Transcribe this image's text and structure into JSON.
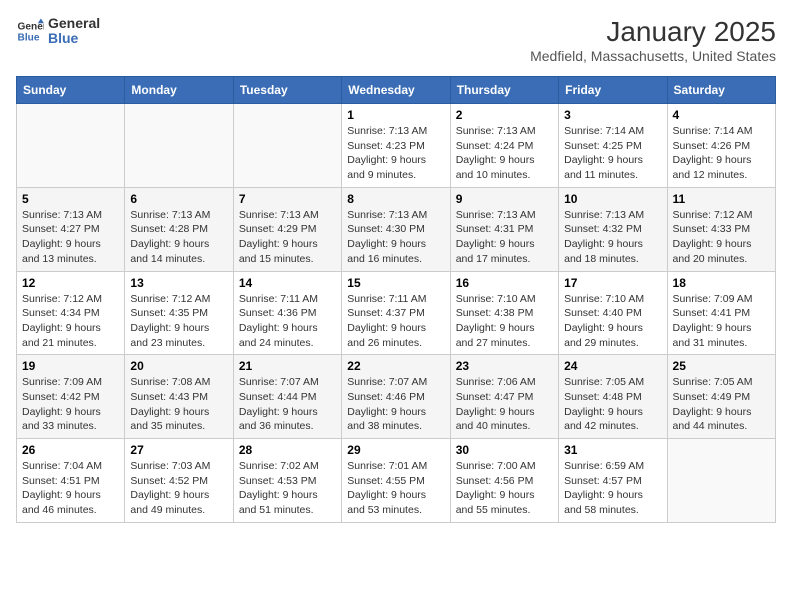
{
  "header": {
    "logo_line1": "General",
    "logo_line2": "Blue",
    "title": "January 2025",
    "subtitle": "Medfield, Massachusetts, United States"
  },
  "days_of_week": [
    "Sunday",
    "Monday",
    "Tuesday",
    "Wednesday",
    "Thursday",
    "Friday",
    "Saturday"
  ],
  "weeks": [
    [
      {
        "day": "",
        "info": ""
      },
      {
        "day": "",
        "info": ""
      },
      {
        "day": "",
        "info": ""
      },
      {
        "day": "1",
        "info": "Sunrise: 7:13 AM\nSunset: 4:23 PM\nDaylight: 9 hours\nand 9 minutes."
      },
      {
        "day": "2",
        "info": "Sunrise: 7:13 AM\nSunset: 4:24 PM\nDaylight: 9 hours\nand 10 minutes."
      },
      {
        "day": "3",
        "info": "Sunrise: 7:14 AM\nSunset: 4:25 PM\nDaylight: 9 hours\nand 11 minutes."
      },
      {
        "day": "4",
        "info": "Sunrise: 7:14 AM\nSunset: 4:26 PM\nDaylight: 9 hours\nand 12 minutes."
      }
    ],
    [
      {
        "day": "5",
        "info": "Sunrise: 7:13 AM\nSunset: 4:27 PM\nDaylight: 9 hours\nand 13 minutes."
      },
      {
        "day": "6",
        "info": "Sunrise: 7:13 AM\nSunset: 4:28 PM\nDaylight: 9 hours\nand 14 minutes."
      },
      {
        "day": "7",
        "info": "Sunrise: 7:13 AM\nSunset: 4:29 PM\nDaylight: 9 hours\nand 15 minutes."
      },
      {
        "day": "8",
        "info": "Sunrise: 7:13 AM\nSunset: 4:30 PM\nDaylight: 9 hours\nand 16 minutes."
      },
      {
        "day": "9",
        "info": "Sunrise: 7:13 AM\nSunset: 4:31 PM\nDaylight: 9 hours\nand 17 minutes."
      },
      {
        "day": "10",
        "info": "Sunrise: 7:13 AM\nSunset: 4:32 PM\nDaylight: 9 hours\nand 18 minutes."
      },
      {
        "day": "11",
        "info": "Sunrise: 7:12 AM\nSunset: 4:33 PM\nDaylight: 9 hours\nand 20 minutes."
      }
    ],
    [
      {
        "day": "12",
        "info": "Sunrise: 7:12 AM\nSunset: 4:34 PM\nDaylight: 9 hours\nand 21 minutes."
      },
      {
        "day": "13",
        "info": "Sunrise: 7:12 AM\nSunset: 4:35 PM\nDaylight: 9 hours\nand 23 minutes."
      },
      {
        "day": "14",
        "info": "Sunrise: 7:11 AM\nSunset: 4:36 PM\nDaylight: 9 hours\nand 24 minutes."
      },
      {
        "day": "15",
        "info": "Sunrise: 7:11 AM\nSunset: 4:37 PM\nDaylight: 9 hours\nand 26 minutes."
      },
      {
        "day": "16",
        "info": "Sunrise: 7:10 AM\nSunset: 4:38 PM\nDaylight: 9 hours\nand 27 minutes."
      },
      {
        "day": "17",
        "info": "Sunrise: 7:10 AM\nSunset: 4:40 PM\nDaylight: 9 hours\nand 29 minutes."
      },
      {
        "day": "18",
        "info": "Sunrise: 7:09 AM\nSunset: 4:41 PM\nDaylight: 9 hours\nand 31 minutes."
      }
    ],
    [
      {
        "day": "19",
        "info": "Sunrise: 7:09 AM\nSunset: 4:42 PM\nDaylight: 9 hours\nand 33 minutes."
      },
      {
        "day": "20",
        "info": "Sunrise: 7:08 AM\nSunset: 4:43 PM\nDaylight: 9 hours\nand 35 minutes."
      },
      {
        "day": "21",
        "info": "Sunrise: 7:07 AM\nSunset: 4:44 PM\nDaylight: 9 hours\nand 36 minutes."
      },
      {
        "day": "22",
        "info": "Sunrise: 7:07 AM\nSunset: 4:46 PM\nDaylight: 9 hours\nand 38 minutes."
      },
      {
        "day": "23",
        "info": "Sunrise: 7:06 AM\nSunset: 4:47 PM\nDaylight: 9 hours\nand 40 minutes."
      },
      {
        "day": "24",
        "info": "Sunrise: 7:05 AM\nSunset: 4:48 PM\nDaylight: 9 hours\nand 42 minutes."
      },
      {
        "day": "25",
        "info": "Sunrise: 7:05 AM\nSunset: 4:49 PM\nDaylight: 9 hours\nand 44 minutes."
      }
    ],
    [
      {
        "day": "26",
        "info": "Sunrise: 7:04 AM\nSunset: 4:51 PM\nDaylight: 9 hours\nand 46 minutes."
      },
      {
        "day": "27",
        "info": "Sunrise: 7:03 AM\nSunset: 4:52 PM\nDaylight: 9 hours\nand 49 minutes."
      },
      {
        "day": "28",
        "info": "Sunrise: 7:02 AM\nSunset: 4:53 PM\nDaylight: 9 hours\nand 51 minutes."
      },
      {
        "day": "29",
        "info": "Sunrise: 7:01 AM\nSunset: 4:55 PM\nDaylight: 9 hours\nand 53 minutes."
      },
      {
        "day": "30",
        "info": "Sunrise: 7:00 AM\nSunset: 4:56 PM\nDaylight: 9 hours\nand 55 minutes."
      },
      {
        "day": "31",
        "info": "Sunrise: 6:59 AM\nSunset: 4:57 PM\nDaylight: 9 hours\nand 58 minutes."
      },
      {
        "day": "",
        "info": ""
      }
    ]
  ]
}
